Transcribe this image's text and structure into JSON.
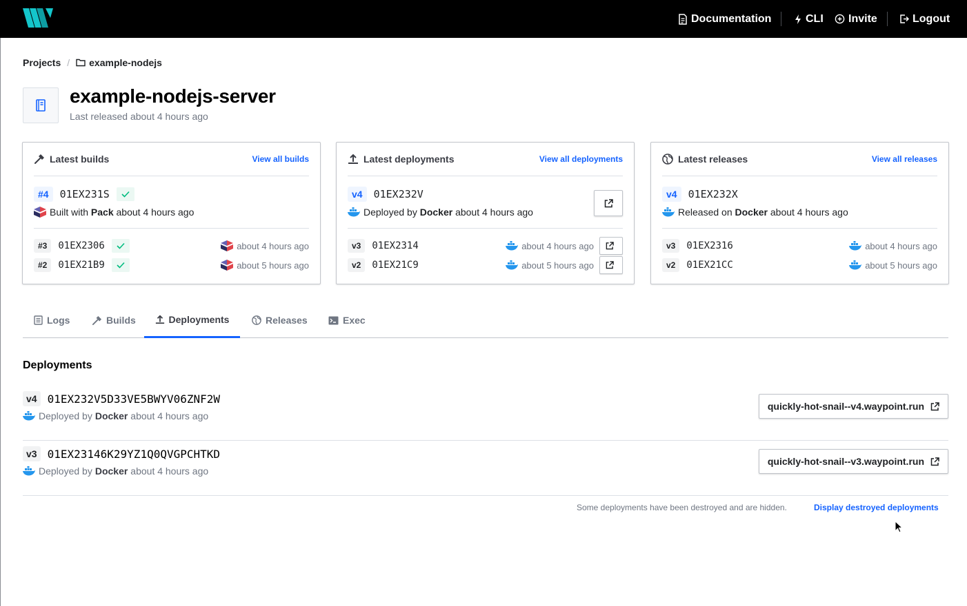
{
  "topnav": {
    "logo_icon": "waypoint-logo-icon",
    "documentation": "Documentation",
    "cli": "CLI",
    "invite": "Invite",
    "logout": "Logout"
  },
  "breadcrumb": {
    "projects": "Projects",
    "separator": "/",
    "current": "example-nodejs"
  },
  "app": {
    "title": "example-nodejs-server",
    "subtitle": "Last released about 4 hours ago"
  },
  "cards": {
    "builds": {
      "title": "Latest builds",
      "link": "View all builds",
      "latest": {
        "badge": "#4",
        "id": "01EX231S",
        "status": "success",
        "desc_prefix": "Built with",
        "desc_tool": "Pack",
        "desc_time": "about 4 hours ago"
      },
      "rows": [
        {
          "badge": "#3",
          "id": "01EX2306",
          "time": "about 4 hours ago"
        },
        {
          "badge": "#2",
          "id": "01EX21B9",
          "time": "about 5 hours ago"
        }
      ]
    },
    "deployments": {
      "title": "Latest deployments",
      "link": "View all deployments",
      "latest": {
        "badge": "v4",
        "id": "01EX232V",
        "desc_prefix": "Deployed by",
        "desc_tool": "Docker",
        "desc_time": "about 4 hours ago"
      },
      "rows": [
        {
          "badge": "v3",
          "id": "01EX2314",
          "time": "about 4 hours ago"
        },
        {
          "badge": "v2",
          "id": "01EX21C9",
          "time": "about 5 hours ago"
        }
      ]
    },
    "releases": {
      "title": "Latest releases",
      "link": "View all releases",
      "latest": {
        "badge": "v4",
        "id": "01EX232X",
        "desc_prefix": "Released on",
        "desc_tool": "Docker",
        "desc_time": "about 4 hours ago"
      },
      "rows": [
        {
          "badge": "v3",
          "id": "01EX2316",
          "time": "about 4 hours ago"
        },
        {
          "badge": "v2",
          "id": "01EX21CC",
          "time": "about 5 hours ago"
        }
      ]
    }
  },
  "tabs": {
    "logs": "Logs",
    "builds": "Builds",
    "deployments": "Deployments",
    "releases": "Releases",
    "exec": "Exec",
    "active": "Deployments"
  },
  "deployments": {
    "heading": "Deployments",
    "items": [
      {
        "badge": "v4",
        "id": "01EX232V5D33VE5BWYV06ZNF2W",
        "prefix": "Deployed by",
        "tool": "Docker",
        "time": "about 4 hours ago",
        "url": "quickly-hot-snail--v4.waypoint.run"
      },
      {
        "badge": "v3",
        "id": "01EX23146K29YZ1Q0QVGPCHTKD",
        "prefix": "Deployed by",
        "tool": "Docker",
        "time": "about 4 hours ago",
        "url": "quickly-hot-snail--v3.waypoint.run"
      }
    ],
    "hidden_note": "Some deployments have been destroyed and are hidden.",
    "display_destroyed": "Display destroyed deployments"
  },
  "colors": {
    "accent": "#1563ff",
    "nav_bg": "#000000",
    "success": "#00bc7f",
    "docker": "#2496ed",
    "logo": "#14c6cb"
  }
}
